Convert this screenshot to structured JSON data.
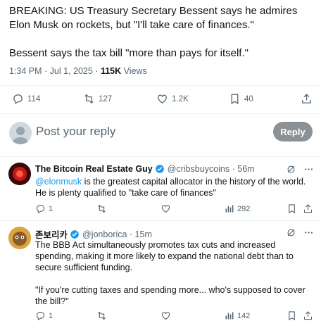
{
  "main_post": {
    "text": "BREAKING: US Treasury Secretary Bessent says he admires Elon Musk on rockets, but \"I'll take care of finances.\"\n\nBessent says the tax bill \"more than pays for itself.\"",
    "time": "1:34 PM · Jul 1, 2025 · ",
    "views_count": "115K",
    "views_label": " Views",
    "actions": {
      "replies": "114",
      "reposts": "127",
      "likes": "1.2K",
      "bookmarks": "40"
    }
  },
  "reply_box": {
    "placeholder": "Post your reply",
    "button": "Reply"
  },
  "replies": [
    {
      "name": "The Bitcoin Real Estate Guy",
      "handle": "@cribsbuycoins · 56m",
      "mention": "@elonmusk",
      "text": " is the greatest capital allocator in the history of the world.  He is plenty qualified to \"take care of finances\"",
      "actions": {
        "replies": "1",
        "reposts": "",
        "likes": "",
        "views": "292"
      }
    },
    {
      "name": "존보리카",
      "handle": "@jonborica · 15m",
      "text": "The BBB Act simultaneously promotes tax cuts and increased spending, making it more likely to expand the national debt than to secure sufficient funding.\n\n\"If you're cutting taxes and spending more... who's supposed to cover the bill?\"",
      "actions": {
        "replies": "1",
        "reposts": "",
        "likes": "",
        "views": "142"
      }
    }
  ],
  "colors": {
    "accent": "#1d9bf0",
    "text": "#0f1419",
    "muted": "#536471",
    "reply_button": "#8c9195"
  },
  "icons": [
    "reply-icon",
    "repost-icon",
    "like-icon",
    "bookmark-icon",
    "share-icon",
    "verified-icon",
    "grok-icon",
    "more-icon",
    "views-icon"
  ]
}
